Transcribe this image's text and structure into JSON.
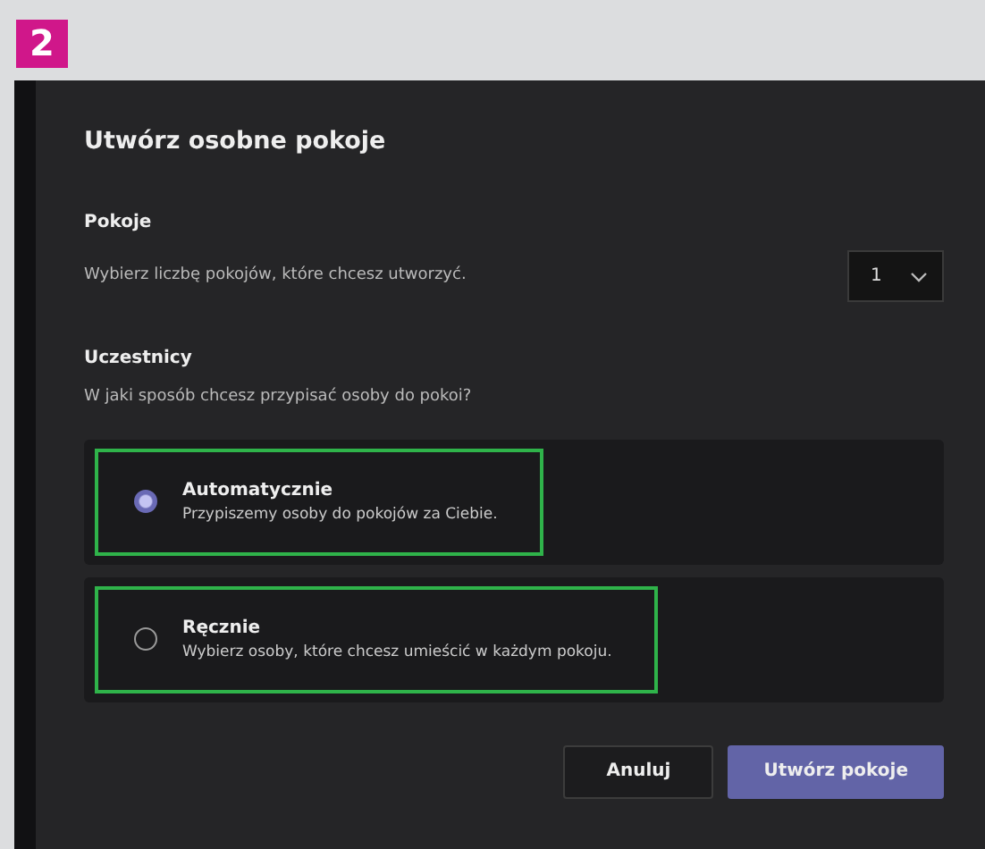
{
  "step_badge": "2",
  "dialog": {
    "title": "Utwórz osobne pokoje",
    "rooms": {
      "label": "Pokoje",
      "description": "Wybierz liczbę pokojów, które chcesz utworzyć.",
      "dropdown_value": "1"
    },
    "participants": {
      "label": "Uczestnicy",
      "question": "W jaki sposób chcesz przypisać osoby do pokoi?",
      "options": [
        {
          "title": "Automatycznie",
          "description": "Przypiszemy osoby do pokojów za Ciebie.",
          "selected": true,
          "highlighted": true
        },
        {
          "title": "Ręcznie",
          "description": "Wybierz osoby, które chcesz umieścić w każdym pokoju.",
          "selected": false,
          "highlighted": true
        }
      ]
    },
    "buttons": [
      {
        "label": "Anuluj",
        "kind": "secondary"
      },
      {
        "label": "Utwórz pokoje",
        "kind": "primary"
      }
    ]
  }
}
